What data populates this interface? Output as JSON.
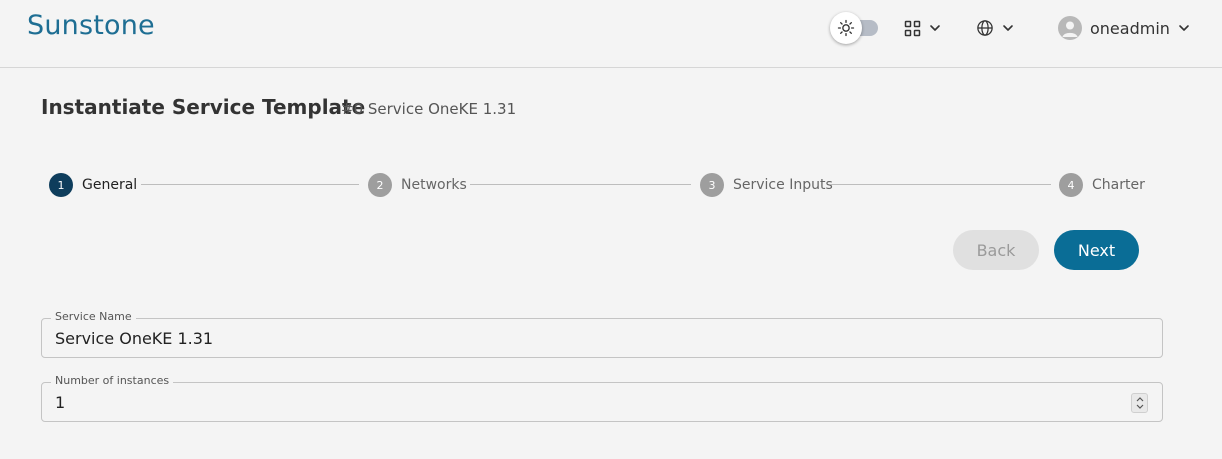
{
  "header": {
    "logo": "Sunstone",
    "theme_toggle": {
      "state": "light"
    },
    "user": {
      "name": "oneadmin"
    }
  },
  "page": {
    "title": "Instantiate Service Template",
    "subtitle": "#0 Service OneKE 1.31"
  },
  "stepper": {
    "active_index": 0,
    "steps": [
      {
        "number": "1",
        "label": "General"
      },
      {
        "number": "2",
        "label": "Networks"
      },
      {
        "number": "3",
        "label": "Service Inputs"
      },
      {
        "number": "4",
        "label": "Charter"
      }
    ]
  },
  "actions": {
    "back_label": "Back",
    "next_label": "Next"
  },
  "form": {
    "service_name": {
      "label": "Service Name",
      "value": "Service OneKE 1.31"
    },
    "instances": {
      "label": "Number of instances",
      "value": "1"
    }
  },
  "colors": {
    "brand": "#1e6e93",
    "primary_button": "#0a6d96",
    "active_step": "#0e3d5c"
  }
}
